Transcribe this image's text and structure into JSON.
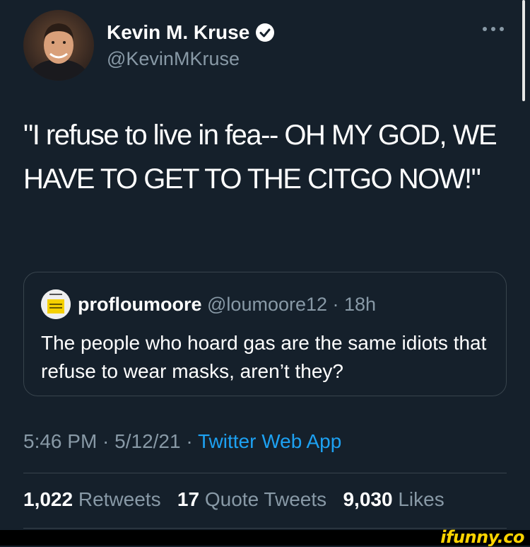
{
  "author": {
    "name": "Kevin M. Kruse",
    "handle": "@KevinMKruse",
    "verified_icon": "verified-badge-icon",
    "more_icon": "more-horizontal-icon"
  },
  "tweet": {
    "text": "\"I refuse to live in fea-- OH MY GOD, WE HAVE TO GET TO THE CITGO NOW!\""
  },
  "quote": {
    "name": "profloumoore",
    "handle_time": "@loumoore12 · 18h",
    "text": "The people who hoard gas are the same idiots that refuse to wear masks, aren’t they?"
  },
  "meta": {
    "datetime": "5:46 PM · 5/12/21 · ",
    "app": "Twitter Web App"
  },
  "stats": {
    "retweets_count": "1,022",
    "retweets_label": "Retweets",
    "quotes_count": "17",
    "quotes_label": "Quote Tweets",
    "likes_count": "9,030",
    "likes_label": "Likes"
  },
  "watermark": "ifunny.co",
  "colors": {
    "background": "#15202b",
    "secondary_text": "#8899a6",
    "link": "#1da1f2",
    "border": "#38444d"
  }
}
